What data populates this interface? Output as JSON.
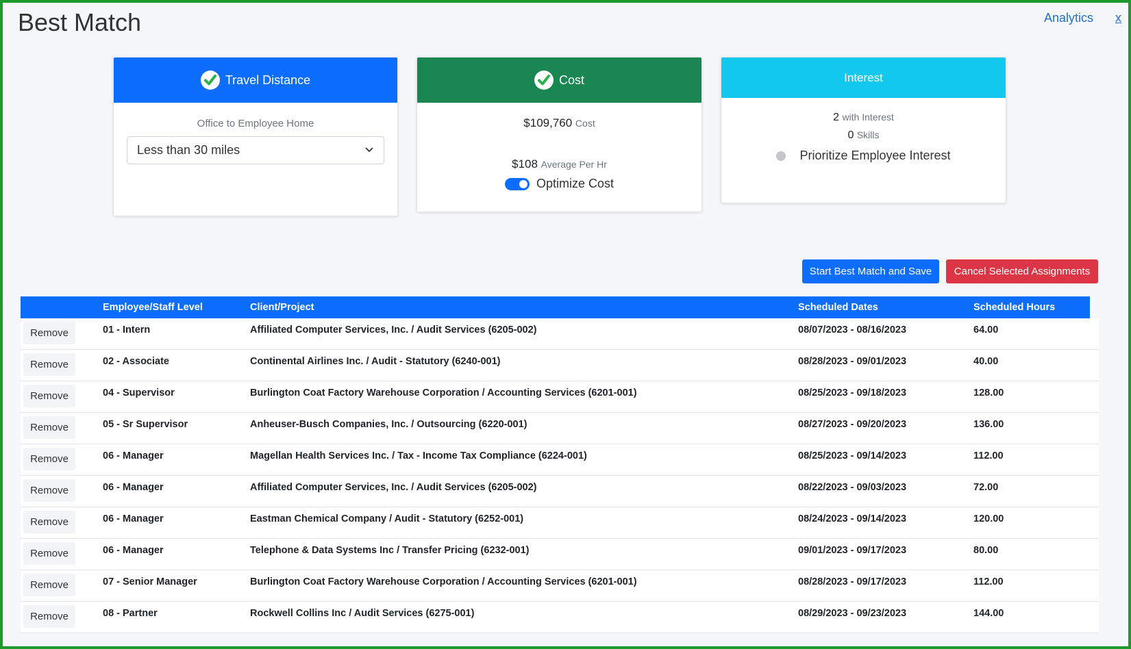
{
  "page": {
    "title": "Best Match",
    "analytics_link": "Analytics",
    "close_link": "x"
  },
  "travel_card": {
    "header": "Travel Distance",
    "subtitle": "Office to Employee Home",
    "select_value": "Less than 30 miles",
    "color": "#0d6efd"
  },
  "cost_card": {
    "header": "Cost",
    "total_value": "$109,760",
    "total_label": "Cost",
    "avg_value": "$108",
    "avg_label": "Average Per Hr",
    "toggle_label": "Optimize Cost",
    "toggle_on": true,
    "color": "#1a8753"
  },
  "interest_card": {
    "header": "Interest",
    "interest_count": "2",
    "interest_label": "with Interest",
    "skills_count": "0",
    "skills_label": "Skills",
    "radio_label": "Prioritize Employee Interest",
    "color": "#11c9ec"
  },
  "actions": {
    "start_button": "Start Best Match and Save",
    "cancel_button": "Cancel Selected Assignments"
  },
  "table": {
    "columns": [
      "",
      "Employee/Staff Level",
      "Client/Project",
      "Scheduled Dates",
      "Scheduled Hours"
    ],
    "remove_label": "Remove",
    "rows": [
      {
        "level": "01 - Intern",
        "project": "Affiliated Computer Services, Inc. / Audit Services (6205-002)",
        "dates": "08/07/2023 - 08/16/2023",
        "hours": "64.00"
      },
      {
        "level": "02 - Associate",
        "project": "Continental Airlines Inc. / Audit - Statutory (6240-001)",
        "dates": "08/28/2023 - 09/01/2023",
        "hours": "40.00"
      },
      {
        "level": "04 - Supervisor",
        "project": "Burlington Coat Factory Warehouse Corporation / Accounting Services (6201-001)",
        "dates": "08/25/2023 - 09/18/2023",
        "hours": "128.00"
      },
      {
        "level": "05 - Sr Supervisor",
        "project": "Anheuser-Busch Companies, Inc. / Outsourcing (6220-001)",
        "dates": "08/27/2023 - 09/20/2023",
        "hours": "136.00"
      },
      {
        "level": "06 - Manager",
        "project": "Magellan Health Services Inc. / Tax - Income Tax Compliance (6224-001)",
        "dates": "08/25/2023 - 09/14/2023",
        "hours": "112.00"
      },
      {
        "level": "06 - Manager",
        "project": "Affiliated Computer Services, Inc. / Audit Services (6205-002)",
        "dates": "08/22/2023 - 09/03/2023",
        "hours": "72.00"
      },
      {
        "level": "06 - Manager",
        "project": "Eastman Chemical Company / Audit - Statutory (6252-001)",
        "dates": "08/24/2023 - 09/14/2023",
        "hours": "120.00"
      },
      {
        "level": "06 - Manager",
        "project": "Telephone & Data Systems Inc / Transfer Pricing (6232-001)",
        "dates": "09/01/2023 - 09/17/2023",
        "hours": "80.00"
      },
      {
        "level": "07 - Senior Manager",
        "project": "Burlington Coat Factory Warehouse Corporation / Accounting Services (6201-001)",
        "dates": "08/28/2023 - 09/17/2023",
        "hours": "112.00"
      },
      {
        "level": "08 - Partner",
        "project": "Rockwell Collins Inc / Audit Services (6275-001)",
        "dates": "08/29/2023 - 09/23/2023",
        "hours": "144.00"
      }
    ]
  }
}
